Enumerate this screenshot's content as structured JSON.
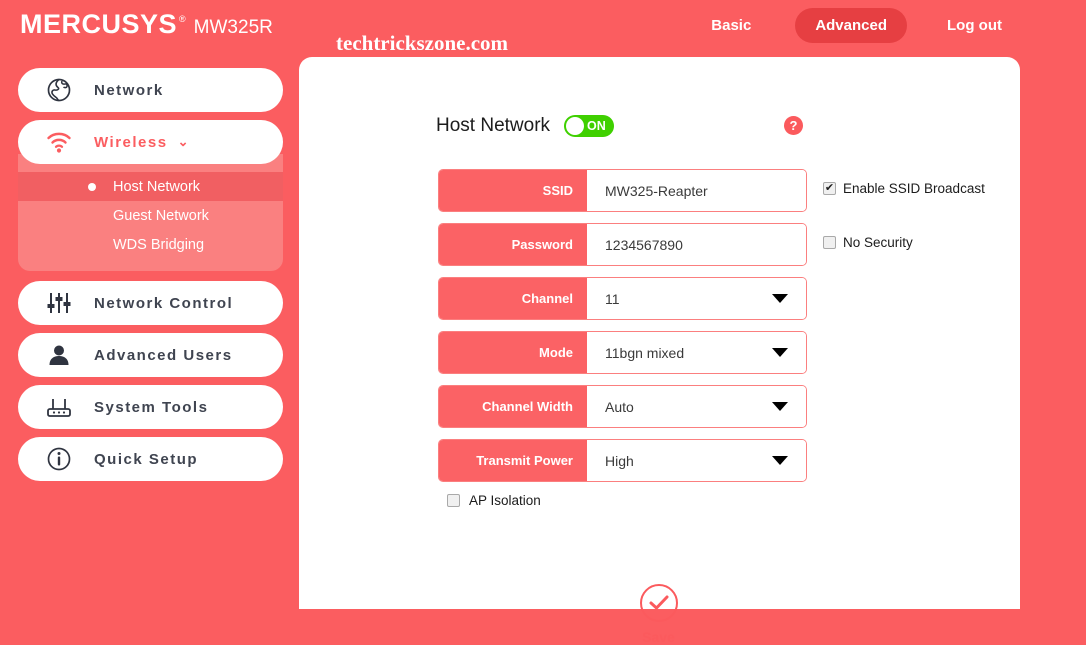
{
  "header": {
    "logo": "MERCUSYS",
    "logo_mark": "®",
    "model": "MW325R",
    "watermark": "techtrickszone.com",
    "nav": [
      {
        "label": "Basic",
        "active": false
      },
      {
        "label": "Advanced",
        "active": true
      },
      {
        "label": "Log out",
        "active": false
      }
    ]
  },
  "sidebar": {
    "items": [
      {
        "label": "Network",
        "icon": "globe-icon"
      },
      {
        "label": "Wireless",
        "icon": "wifi-icon",
        "chevron": "⌄"
      },
      {
        "label": "Network Control",
        "icon": "sliders-icon"
      },
      {
        "label": "Advanced Users",
        "icon": "user-icon"
      },
      {
        "label": "System Tools",
        "icon": "router-icon"
      },
      {
        "label": "Quick Setup",
        "icon": "info-circle-icon"
      }
    ],
    "submenu": [
      {
        "label": "Host Network",
        "active": true
      },
      {
        "label": "Guest Network",
        "active": false
      },
      {
        "label": "WDS Bridging",
        "active": false
      }
    ]
  },
  "main": {
    "title": "Host Network",
    "toggle_label": "ON",
    "toggle_state": "on",
    "help_icon": "?",
    "fields": [
      {
        "label": "SSID",
        "value": "MW325-Reapter",
        "type": "text"
      },
      {
        "label": "Password",
        "value": "1234567890",
        "type": "text"
      },
      {
        "label": "Channel",
        "value": "11",
        "type": "select"
      },
      {
        "label": "Mode",
        "value": "11bgn mixed",
        "type": "select"
      },
      {
        "label": "Channel Width",
        "value": "Auto",
        "type": "select"
      },
      {
        "label": "Transmit Power",
        "value": "High",
        "type": "select"
      }
    ],
    "side_checkboxes": [
      {
        "label": "Enable SSID Broadcast",
        "checked": true
      },
      {
        "label": "No Security",
        "checked": false
      }
    ],
    "ap_isolation": {
      "label": "AP Isolation",
      "checked": false
    },
    "save": {
      "label": "Save",
      "icon": "check-icon"
    }
  },
  "colors": {
    "background": "#fb5d60",
    "panel": "#ffffff",
    "accent": "#fb5a5d",
    "nav_active": "#e63f42",
    "submenu_bg": "#fa8080",
    "submenu_active": "#f15f62",
    "toggle_on": "#3fd000"
  }
}
